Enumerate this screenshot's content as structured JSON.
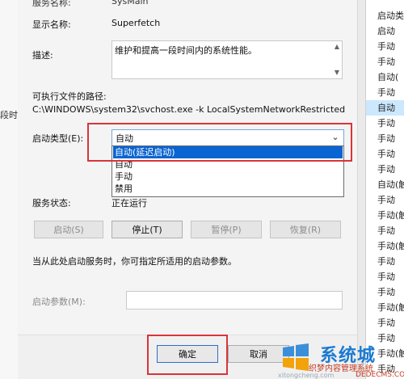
{
  "left_fragment": "段时",
  "labels": {
    "service_name_label": "服务名称:",
    "service_name_value": "SysMain",
    "display_name_label": "显示名称:",
    "display_name_value": "Superfetch",
    "description_label": "描述:",
    "description_value": "维护和提高一段时间内的系统性能。",
    "exe_path_label": "可执行文件的路径:",
    "exe_path_value": "C:\\WINDOWS\\system32\\svchost.exe -k LocalSystemNetworkRestricted",
    "startup_type_label": "启动类型(E):",
    "service_status_label": "服务状态:",
    "service_status_value": "正在运行",
    "hint_text": "当从此处启动服务时，你可指定所适用的启动参数。",
    "start_params_label": "启动参数(M):"
  },
  "startup_type": {
    "selected": "自动",
    "options": [
      "自动(延迟启动)",
      "自动",
      "手动",
      "禁用"
    ],
    "highlighted_index": 0
  },
  "buttons": {
    "start": "启动(S)",
    "stop": "停止(T)",
    "pause": "暂停(P)",
    "resume": "恢复(R)",
    "ok": "确定",
    "cancel": "取消"
  },
  "right_list": [
    "启动类",
    "启动",
    "手动",
    "手动",
    "自动(",
    "手动",
    "自动",
    "手动",
    "手动",
    "手动",
    "手动",
    "自动(触",
    "手动",
    "手动(触",
    "手动",
    "手动(触",
    "手动",
    "手动",
    "手动",
    "手动(触",
    "手动",
    "手动",
    "手动(触",
    "手动",
    "手动"
  ],
  "right_list_selected_index": 6,
  "watermark": {
    "brand": "系统城",
    "line1": "织梦内容管理系统",
    "line2": "DEDECMS.COM",
    "line3": "xitongcheng.com"
  },
  "colors": {
    "highlight_red": "#d9343a",
    "selection_blue": "#0a64d2",
    "watermark_blue": "#1b7ad1"
  }
}
